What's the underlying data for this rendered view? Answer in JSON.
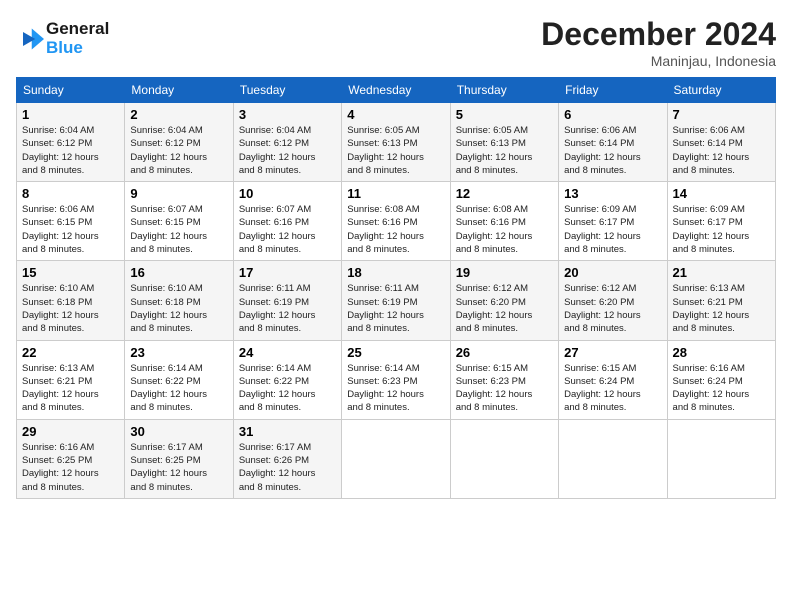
{
  "header": {
    "logo_line1": "General",
    "logo_line2": "Blue",
    "month": "December 2024",
    "location": "Maninjau, Indonesia"
  },
  "weekdays": [
    "Sunday",
    "Monday",
    "Tuesday",
    "Wednesday",
    "Thursday",
    "Friday",
    "Saturday"
  ],
  "weeks": [
    [
      {
        "day": "1",
        "sunrise": "6:04 AM",
        "sunset": "6:12 PM",
        "daylight": "12 hours and 8 minutes."
      },
      {
        "day": "2",
        "sunrise": "6:04 AM",
        "sunset": "6:12 PM",
        "daylight": "12 hours and 8 minutes."
      },
      {
        "day": "3",
        "sunrise": "6:04 AM",
        "sunset": "6:12 PM",
        "daylight": "12 hours and 8 minutes."
      },
      {
        "day": "4",
        "sunrise": "6:05 AM",
        "sunset": "6:13 PM",
        "daylight": "12 hours and 8 minutes."
      },
      {
        "day": "5",
        "sunrise": "6:05 AM",
        "sunset": "6:13 PM",
        "daylight": "12 hours and 8 minutes."
      },
      {
        "day": "6",
        "sunrise": "6:06 AM",
        "sunset": "6:14 PM",
        "daylight": "12 hours and 8 minutes."
      },
      {
        "day": "7",
        "sunrise": "6:06 AM",
        "sunset": "6:14 PM",
        "daylight": "12 hours and 8 minutes."
      }
    ],
    [
      {
        "day": "8",
        "sunrise": "6:06 AM",
        "sunset": "6:15 PM",
        "daylight": "12 hours and 8 minutes."
      },
      {
        "day": "9",
        "sunrise": "6:07 AM",
        "sunset": "6:15 PM",
        "daylight": "12 hours and 8 minutes."
      },
      {
        "day": "10",
        "sunrise": "6:07 AM",
        "sunset": "6:16 PM",
        "daylight": "12 hours and 8 minutes."
      },
      {
        "day": "11",
        "sunrise": "6:08 AM",
        "sunset": "6:16 PM",
        "daylight": "12 hours and 8 minutes."
      },
      {
        "day": "12",
        "sunrise": "6:08 AM",
        "sunset": "6:16 PM",
        "daylight": "12 hours and 8 minutes."
      },
      {
        "day": "13",
        "sunrise": "6:09 AM",
        "sunset": "6:17 PM",
        "daylight": "12 hours and 8 minutes."
      },
      {
        "day": "14",
        "sunrise": "6:09 AM",
        "sunset": "6:17 PM",
        "daylight": "12 hours and 8 minutes."
      }
    ],
    [
      {
        "day": "15",
        "sunrise": "6:10 AM",
        "sunset": "6:18 PM",
        "daylight": "12 hours and 8 minutes."
      },
      {
        "day": "16",
        "sunrise": "6:10 AM",
        "sunset": "6:18 PM",
        "daylight": "12 hours and 8 minutes."
      },
      {
        "day": "17",
        "sunrise": "6:11 AM",
        "sunset": "6:19 PM",
        "daylight": "12 hours and 8 minutes."
      },
      {
        "day": "18",
        "sunrise": "6:11 AM",
        "sunset": "6:19 PM",
        "daylight": "12 hours and 8 minutes."
      },
      {
        "day": "19",
        "sunrise": "6:12 AM",
        "sunset": "6:20 PM",
        "daylight": "12 hours and 8 minutes."
      },
      {
        "day": "20",
        "sunrise": "6:12 AM",
        "sunset": "6:20 PM",
        "daylight": "12 hours and 8 minutes."
      },
      {
        "day": "21",
        "sunrise": "6:13 AM",
        "sunset": "6:21 PM",
        "daylight": "12 hours and 8 minutes."
      }
    ],
    [
      {
        "day": "22",
        "sunrise": "6:13 AM",
        "sunset": "6:21 PM",
        "daylight": "12 hours and 8 minutes."
      },
      {
        "day": "23",
        "sunrise": "6:14 AM",
        "sunset": "6:22 PM",
        "daylight": "12 hours and 8 minutes."
      },
      {
        "day": "24",
        "sunrise": "6:14 AM",
        "sunset": "6:22 PM",
        "daylight": "12 hours and 8 minutes."
      },
      {
        "day": "25",
        "sunrise": "6:14 AM",
        "sunset": "6:23 PM",
        "daylight": "12 hours and 8 minutes."
      },
      {
        "day": "26",
        "sunrise": "6:15 AM",
        "sunset": "6:23 PM",
        "daylight": "12 hours and 8 minutes."
      },
      {
        "day": "27",
        "sunrise": "6:15 AM",
        "sunset": "6:24 PM",
        "daylight": "12 hours and 8 minutes."
      },
      {
        "day": "28",
        "sunrise": "6:16 AM",
        "sunset": "6:24 PM",
        "daylight": "12 hours and 8 minutes."
      }
    ],
    [
      {
        "day": "29",
        "sunrise": "6:16 AM",
        "sunset": "6:25 PM",
        "daylight": "12 hours and 8 minutes."
      },
      {
        "day": "30",
        "sunrise": "6:17 AM",
        "sunset": "6:25 PM",
        "daylight": "12 hours and 8 minutes."
      },
      {
        "day": "31",
        "sunrise": "6:17 AM",
        "sunset": "6:26 PM",
        "daylight": "12 hours and 8 minutes."
      },
      null,
      null,
      null,
      null
    ]
  ]
}
